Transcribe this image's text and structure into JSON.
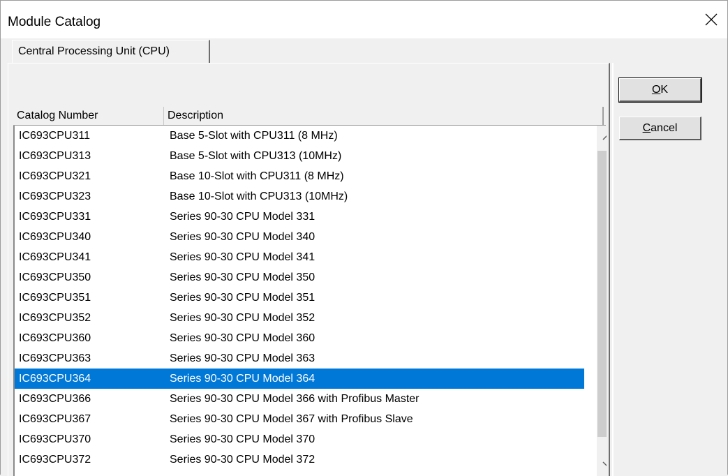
{
  "window": {
    "title": "Module Catalog"
  },
  "tabs": [
    {
      "label": "Central Processing Unit (CPU)",
      "active": true
    }
  ],
  "list": {
    "columns": [
      "Catalog Number",
      "Description"
    ],
    "selected_index": 12,
    "rows": [
      {
        "catalog_number": "IC693CPU311",
        "description": "Base 5-Slot with CPU311 (8 MHz)"
      },
      {
        "catalog_number": "IC693CPU313",
        "description": "Base 5-Slot with CPU313 (10MHz)"
      },
      {
        "catalog_number": "IC693CPU321",
        "description": "Base 10-Slot with CPU311 (8 MHz)"
      },
      {
        "catalog_number": "IC693CPU323",
        "description": "Base 10-Slot with CPU313 (10MHz)"
      },
      {
        "catalog_number": "IC693CPU331",
        "description": "Series 90-30 CPU Model 331"
      },
      {
        "catalog_number": "IC693CPU340",
        "description": "Series 90-30 CPU Model 340"
      },
      {
        "catalog_number": "IC693CPU341",
        "description": "Series 90-30 CPU Model 341"
      },
      {
        "catalog_number": "IC693CPU350",
        "description": "Series 90-30 CPU Model 350"
      },
      {
        "catalog_number": "IC693CPU351",
        "description": "Series 90-30 CPU Model 351"
      },
      {
        "catalog_number": "IC693CPU352",
        "description": "Series 90-30 CPU Model 352"
      },
      {
        "catalog_number": "IC693CPU360",
        "description": "Series 90-30 CPU Model 360"
      },
      {
        "catalog_number": "IC693CPU363",
        "description": "Series 90-30 CPU Model 363"
      },
      {
        "catalog_number": "IC693CPU364",
        "description": "Series 90-30 CPU Model 364"
      },
      {
        "catalog_number": "IC693CPU366",
        "description": "Series 90-30 CPU Model 366 with Profibus Master"
      },
      {
        "catalog_number": "IC693CPU367",
        "description": "Series 90-30 CPU Model 367 with Profibus Slave"
      },
      {
        "catalog_number": "IC693CPU370",
        "description": "Series 90-30 CPU Model 370"
      },
      {
        "catalog_number": "IC693CPU372",
        "description": "Series 90-30 CPU Model 372"
      }
    ]
  },
  "buttons": {
    "ok": {
      "mnemonic": "O",
      "rest": "K"
    },
    "cancel": {
      "mnemonic": "C",
      "rest": "ancel"
    }
  },
  "icons": {
    "close": "close-icon",
    "scroll_up": "chevron-up-icon",
    "scroll_down": "chevron-down-icon"
  },
  "colors": {
    "selection": "#0078d7",
    "window_bg": "#f0f0f0"
  }
}
